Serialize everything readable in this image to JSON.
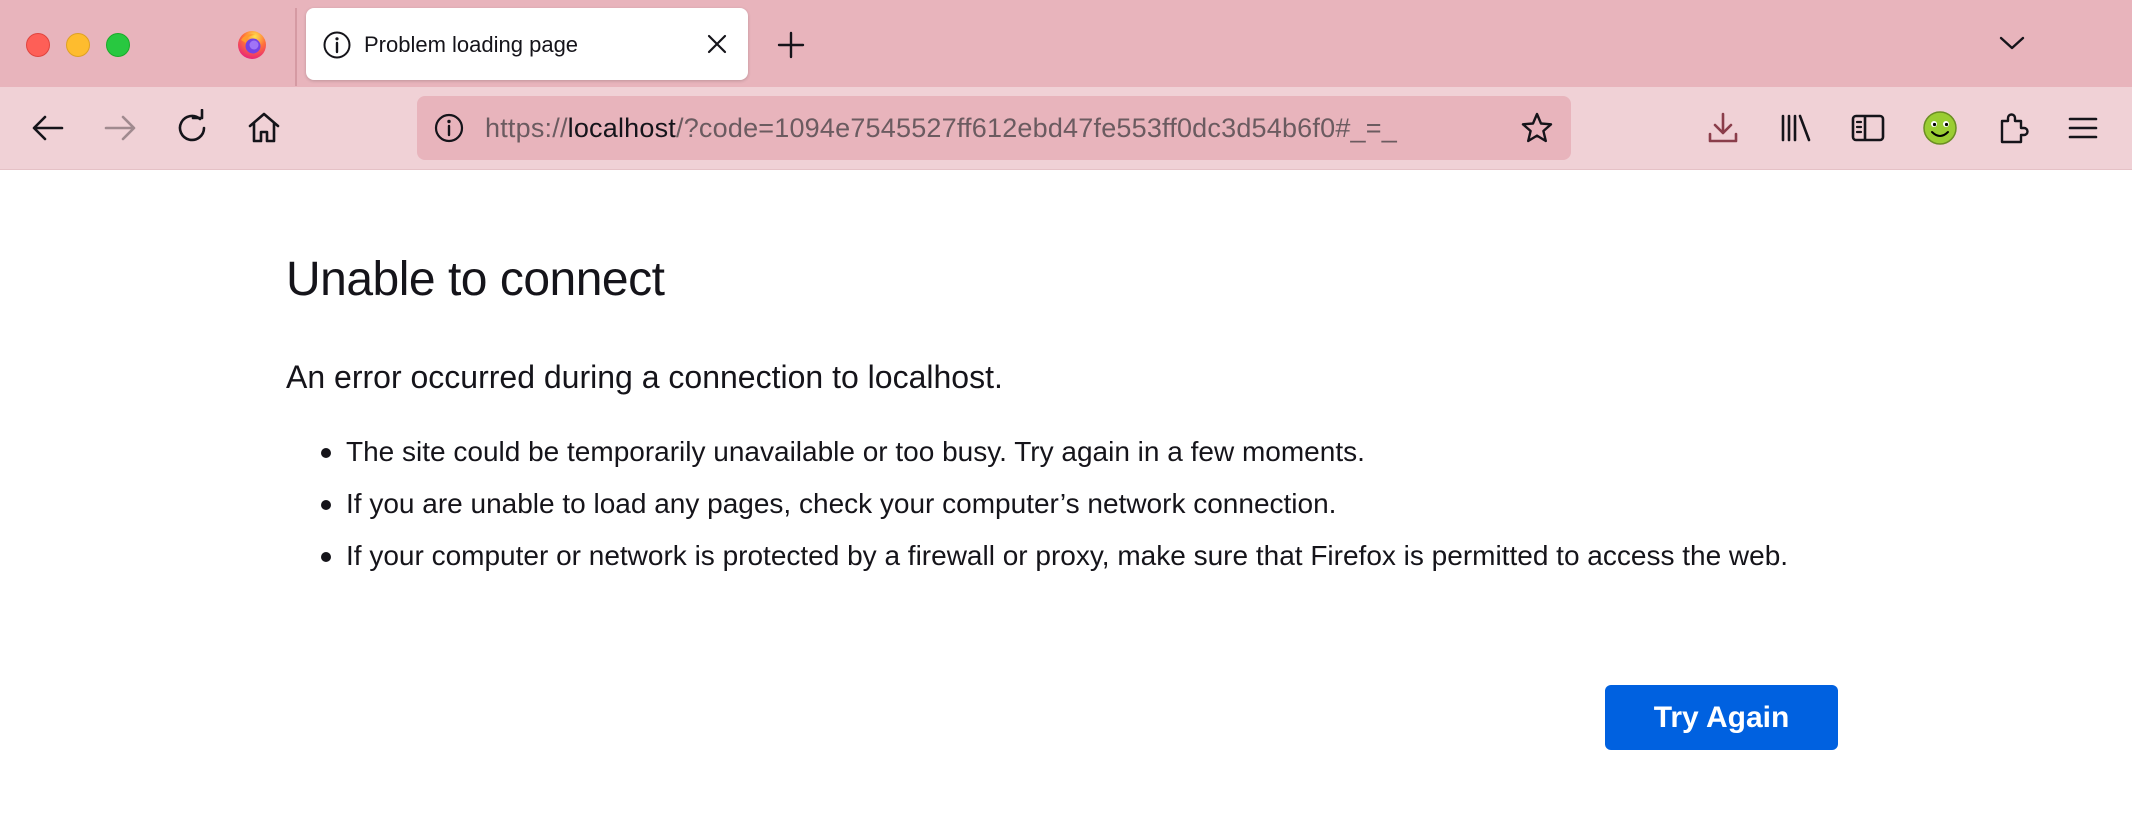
{
  "window": {
    "traffic_lights": [
      "close",
      "minimize",
      "maximize"
    ]
  },
  "tabs": [
    {
      "title": "Problem loading page",
      "icon": "info-icon",
      "active": true
    }
  ],
  "toolbar": {
    "url": {
      "scheme": "https://",
      "host": "localhost",
      "rest": "/?code=1094e7545527ff612ebd47fe553ff0dc3d54b6f0#_=_"
    },
    "icons": [
      "back-icon",
      "forward-icon",
      "reload-icon",
      "home-icon",
      "site-info-icon",
      "bookmark-star-icon",
      "downloads-icon",
      "library-icon",
      "sidebar-icon",
      "extension-smiley-icon",
      "extensions-puzzle-icon",
      "menu-icon"
    ]
  },
  "error_page": {
    "title": "Unable to connect",
    "subtitle": "An error occurred during a connection to localhost.",
    "bullets": [
      "The site could be temporarily unavailable or too busy. Try again in a few moments.",
      "If you are unable to load any pages, check your computer’s network connection.",
      "If your computer or network is protected by a firewall or proxy, make sure that Firefox is permitted to access the web."
    ],
    "try_again_label": "Try Again"
  },
  "colors": {
    "tabbar_bg": "#e8b4bc",
    "navbar_bg": "#f0d1d6",
    "primary_button": "#0061e0"
  }
}
